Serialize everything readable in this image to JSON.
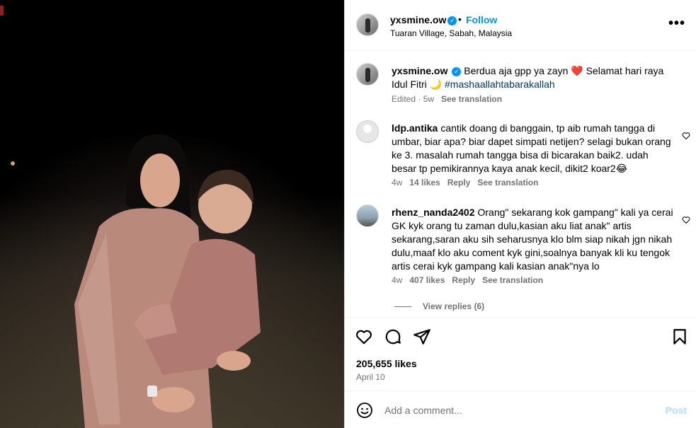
{
  "post": {
    "username": "yxsmine.ow",
    "follow_label": "Follow",
    "dot": "•",
    "location": "Tuaran Village, Sabah, Malaysia",
    "more": "•••"
  },
  "caption": {
    "username": "yxsmine.ow",
    "text_before": "Berdua aja gpp ya zayn ",
    "heart_emoji": "❤️",
    "text_after": " Selamat hari raya Idul Fitri ",
    "moon_emoji": "🌙",
    "hashtag": " #mashaallahtabarakallah",
    "edited": "Edited · 5w",
    "see_translation": "See translation"
  },
  "comments": [
    {
      "username": "ldp.antika",
      "text": "cantik doang di banggain, tp aib rumah tangga di umbar, biar apa? biar dapet simpati netijen? selagi bukan orang ke 3. masalah rumah tangga bisa di bicarakan baik2. udah besar tp pemikirannya kaya anak kecil, dikit2 koar2😂",
      "time": "4w",
      "likes": "14 likes",
      "reply": "Reply",
      "see_translation": "See translation"
    },
    {
      "username": "rhenz_nanda2402",
      "text": "Orang\" sekarang kok gampang\" kali ya cerai GK kyk orang tu zaman dulu,kasian aku liat anak\" artis sekarang,saran aku sih seharusnya klo blm siap nikah jgn nikah dulu,maaf klo aku coment kyk gini,soalnya banyak kli ku tengok artis cerai kyk gampang kali kasian anak\"nya lo",
      "time": "4w",
      "likes": "407 likes",
      "reply": "Reply",
      "see_translation": "See translation"
    }
  ],
  "view_replies": "View replies (6)",
  "likes_count": "205,655 likes",
  "date": "April 10",
  "add_comment": {
    "placeholder": "Add a comment...",
    "post_label": "Post"
  },
  "colors": {
    "accent": "#0095f6",
    "muted": "#737373",
    "post_disabled": "#b3dbff"
  },
  "icons": [
    "heart-icon",
    "comment-icon",
    "share-icon",
    "bookmark-icon",
    "emoji-icon",
    "verified-icon",
    "more-icon"
  ]
}
